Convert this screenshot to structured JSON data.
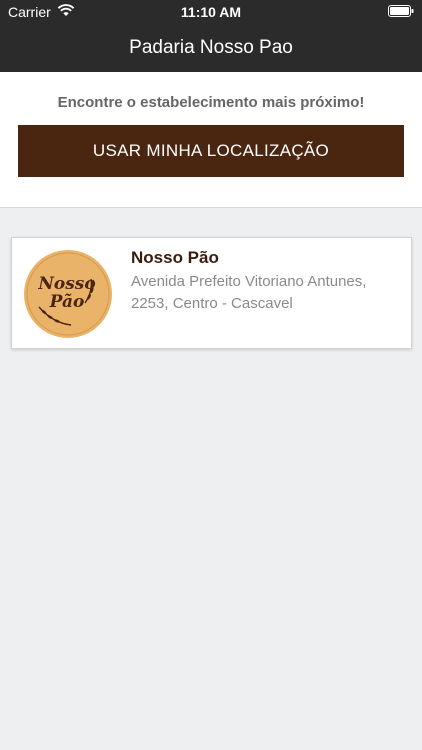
{
  "status_bar": {
    "carrier": "Carrier",
    "time": "11:10 AM"
  },
  "nav": {
    "title": "Padaria Nosso Pao"
  },
  "location": {
    "prompt": "Encontre o estabelecimento mais próximo!",
    "button_label": "USAR MINHA LOCALIZAÇÃO"
  },
  "results": [
    {
      "name": "Nosso Pão",
      "address": "Avenida Prefeito Vitoriano Antunes, 2253, Centro - Cascavel",
      "logo_text_line1": "Nosso",
      "logo_text_line2": "Pão"
    }
  ],
  "colors": {
    "bar_background": "#2b2b2b",
    "button_brown": "#4a2510",
    "logo_fill": "#eab36a",
    "logo_ink": "#4a2510",
    "page_background": "#eeeff1"
  },
  "icons": {
    "wifi": "wifi-icon",
    "battery": "battery-icon",
    "wheat": "wheat-icon"
  }
}
